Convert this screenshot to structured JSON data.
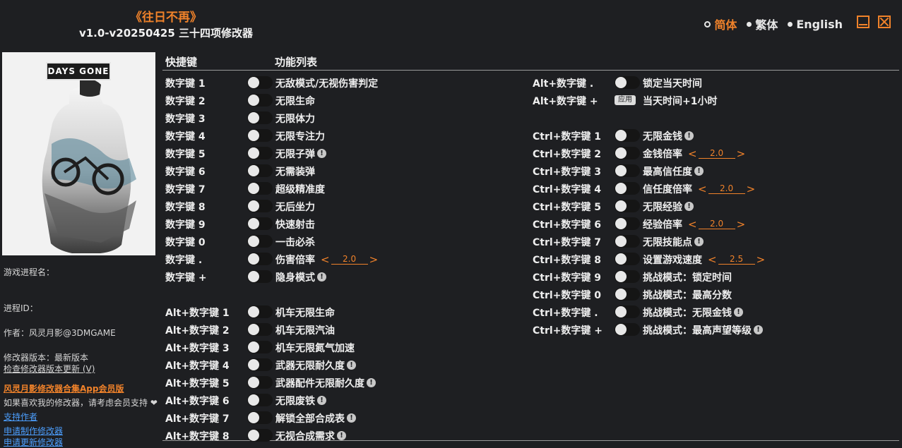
{
  "header": {
    "game_title": "《往日不再》",
    "version_title": "v1.0-v20250425 三十四项修改器"
  },
  "languages": [
    {
      "label": "简体",
      "active": true
    },
    {
      "label": "繁体",
      "active": false
    },
    {
      "label": "English",
      "active": false
    }
  ],
  "cover": {
    "logo_text": "DAYS GONE"
  },
  "info": {
    "process_name": "游戏进程名：",
    "process_id": "进程ID：",
    "author": "作者：风灵月影@3DMGAME",
    "trainer_version": "修改器版本：最新版本",
    "check_update": "检查修改器版本更新 (V)",
    "app_member": "风灵月影修改器合集App会员版",
    "support_text": "如果喜欢我的修改器，请考虑会员支持 ❤",
    "support_author": "支持作者",
    "request_trainer": "申请制作修改器",
    "request_update": "申请更新修改器"
  },
  "columns": {
    "hotkey": "快捷键",
    "features": "功能列表"
  },
  "left_list": [
    {
      "hotkey": "数字键 1",
      "label": "无敌模式/无视伤害判定",
      "warn": false
    },
    {
      "hotkey": "数字键 2",
      "label": "无限生命",
      "warn": false
    },
    {
      "hotkey": "数字键 3",
      "label": "无限体力",
      "warn": false
    },
    {
      "hotkey": "数字键 4",
      "label": "无限专注力",
      "warn": false
    },
    {
      "hotkey": "数字键 5",
      "label": "无限子弹",
      "warn": true
    },
    {
      "hotkey": "数字键 6",
      "label": "无需装弹",
      "warn": false
    },
    {
      "hotkey": "数字键 7",
      "label": "超级精准度",
      "warn": false
    },
    {
      "hotkey": "数字键 8",
      "label": "无后坐力",
      "warn": false
    },
    {
      "hotkey": "数字键 9",
      "label": "快速射击",
      "warn": false
    },
    {
      "hotkey": "数字键 0",
      "label": "一击必杀",
      "warn": false
    },
    {
      "hotkey": "数字键 .",
      "label": "伤害倍率",
      "warn": false,
      "value": "2.0"
    },
    {
      "hotkey": "数字键 +",
      "label": "隐身模式",
      "warn": true
    },
    null,
    {
      "hotkey": "Alt+数字键 1",
      "label": "机车无限生命",
      "warn": false
    },
    {
      "hotkey": "Alt+数字键 2",
      "label": "机车无限汽油",
      "warn": false
    },
    {
      "hotkey": "Alt+数字键 3",
      "label": "机车无限氮气加速",
      "warn": false
    },
    {
      "hotkey": "Alt+数字键 4",
      "label": "武器无限耐久度",
      "warn": true
    },
    {
      "hotkey": "Alt+数字键 5",
      "label": "武器配件无限耐久度",
      "warn": true
    },
    {
      "hotkey": "Alt+数字键 6",
      "label": "无限废铁",
      "warn": true
    },
    {
      "hotkey": "Alt+数字键 7",
      "label": "解锁全部合成表",
      "warn": true
    },
    {
      "hotkey": "Alt+数字键 8",
      "label": "无视合成需求",
      "warn": true
    }
  ],
  "right_list": [
    {
      "hotkey": "Alt+数字键 .",
      "label": "锁定当天时间",
      "warn": false
    },
    {
      "hotkey": "Alt+数字键 +",
      "label": "当天时间+1小时",
      "warn": false,
      "apply": "应用"
    },
    null,
    {
      "hotkey": "Ctrl+数字键 1",
      "label": "无限金钱",
      "warn": true
    },
    {
      "hotkey": "Ctrl+数字键 2",
      "label": "金钱倍率",
      "warn": false,
      "value": "2.0"
    },
    {
      "hotkey": "Ctrl+数字键 3",
      "label": "最高信任度",
      "warn": true
    },
    {
      "hotkey": "Ctrl+数字键 4",
      "label": "信任度倍率",
      "warn": false,
      "value": "2.0"
    },
    {
      "hotkey": "Ctrl+数字键 5",
      "label": "无限经验",
      "warn": true
    },
    {
      "hotkey": "Ctrl+数字键 6",
      "label": "经验倍率",
      "warn": false,
      "value": "2.0"
    },
    {
      "hotkey": "Ctrl+数字键 7",
      "label": "无限技能点",
      "warn": true
    },
    {
      "hotkey": "Ctrl+数字键 8",
      "label": "设置游戏速度",
      "warn": false,
      "value": "2.5"
    },
    {
      "hotkey": "Ctrl+数字键 9",
      "label": "挑战模式：锁定时间",
      "warn": false
    },
    {
      "hotkey": "Ctrl+数字键 0",
      "label": "挑战模式：最高分数",
      "warn": false
    },
    {
      "hotkey": "Ctrl+数字键 .",
      "label": "挑战模式：无限金钱",
      "warn": true
    },
    {
      "hotkey": "Ctrl+数字键 +",
      "label": "挑战模式：最高声望等级",
      "warn": true
    }
  ],
  "colors": {
    "accent": "#f0822a",
    "background": "#1e1f22",
    "link": "#4c9fff"
  }
}
